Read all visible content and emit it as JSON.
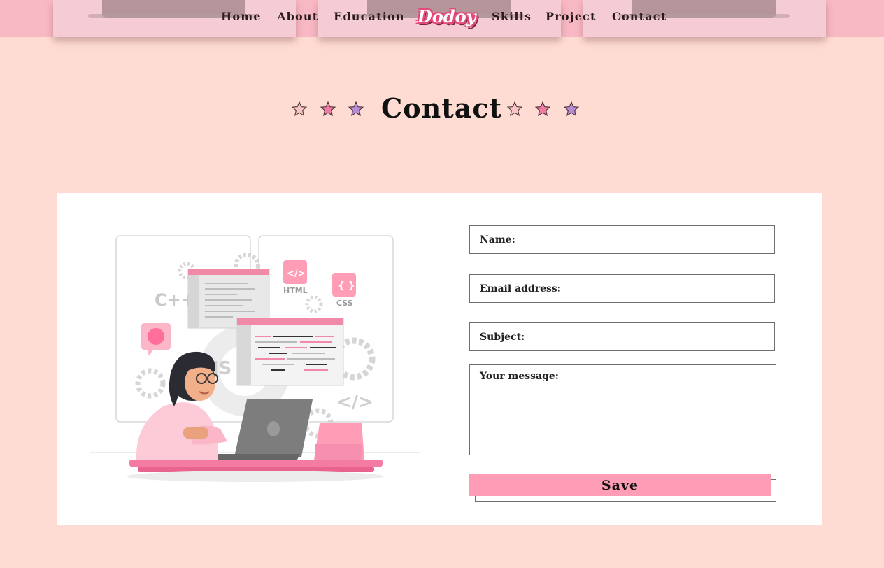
{
  "nav": {
    "items": [
      "Home",
      "About",
      "Education",
      "Skills",
      "Project",
      "Contact"
    ],
    "logo": "Dodoy"
  },
  "section": {
    "title": "Contact",
    "star_colors": [
      "#fbc4c4",
      "#f27aa3",
      "#b98cd6"
    ]
  },
  "form": {
    "name_placeholder": "Name:",
    "email_placeholder": "Email address:",
    "subject_placeholder": "Subject:",
    "message_placeholder": "Your message:",
    "save_label": "Save"
  },
  "illustration": {
    "tags": [
      "C++",
      "HTML",
      "CSS",
      "</>",
      "JS"
    ]
  },
  "colors": {
    "background": "#fedcd4",
    "nav": "#f8b8c4",
    "accent": "#ff9db6"
  }
}
